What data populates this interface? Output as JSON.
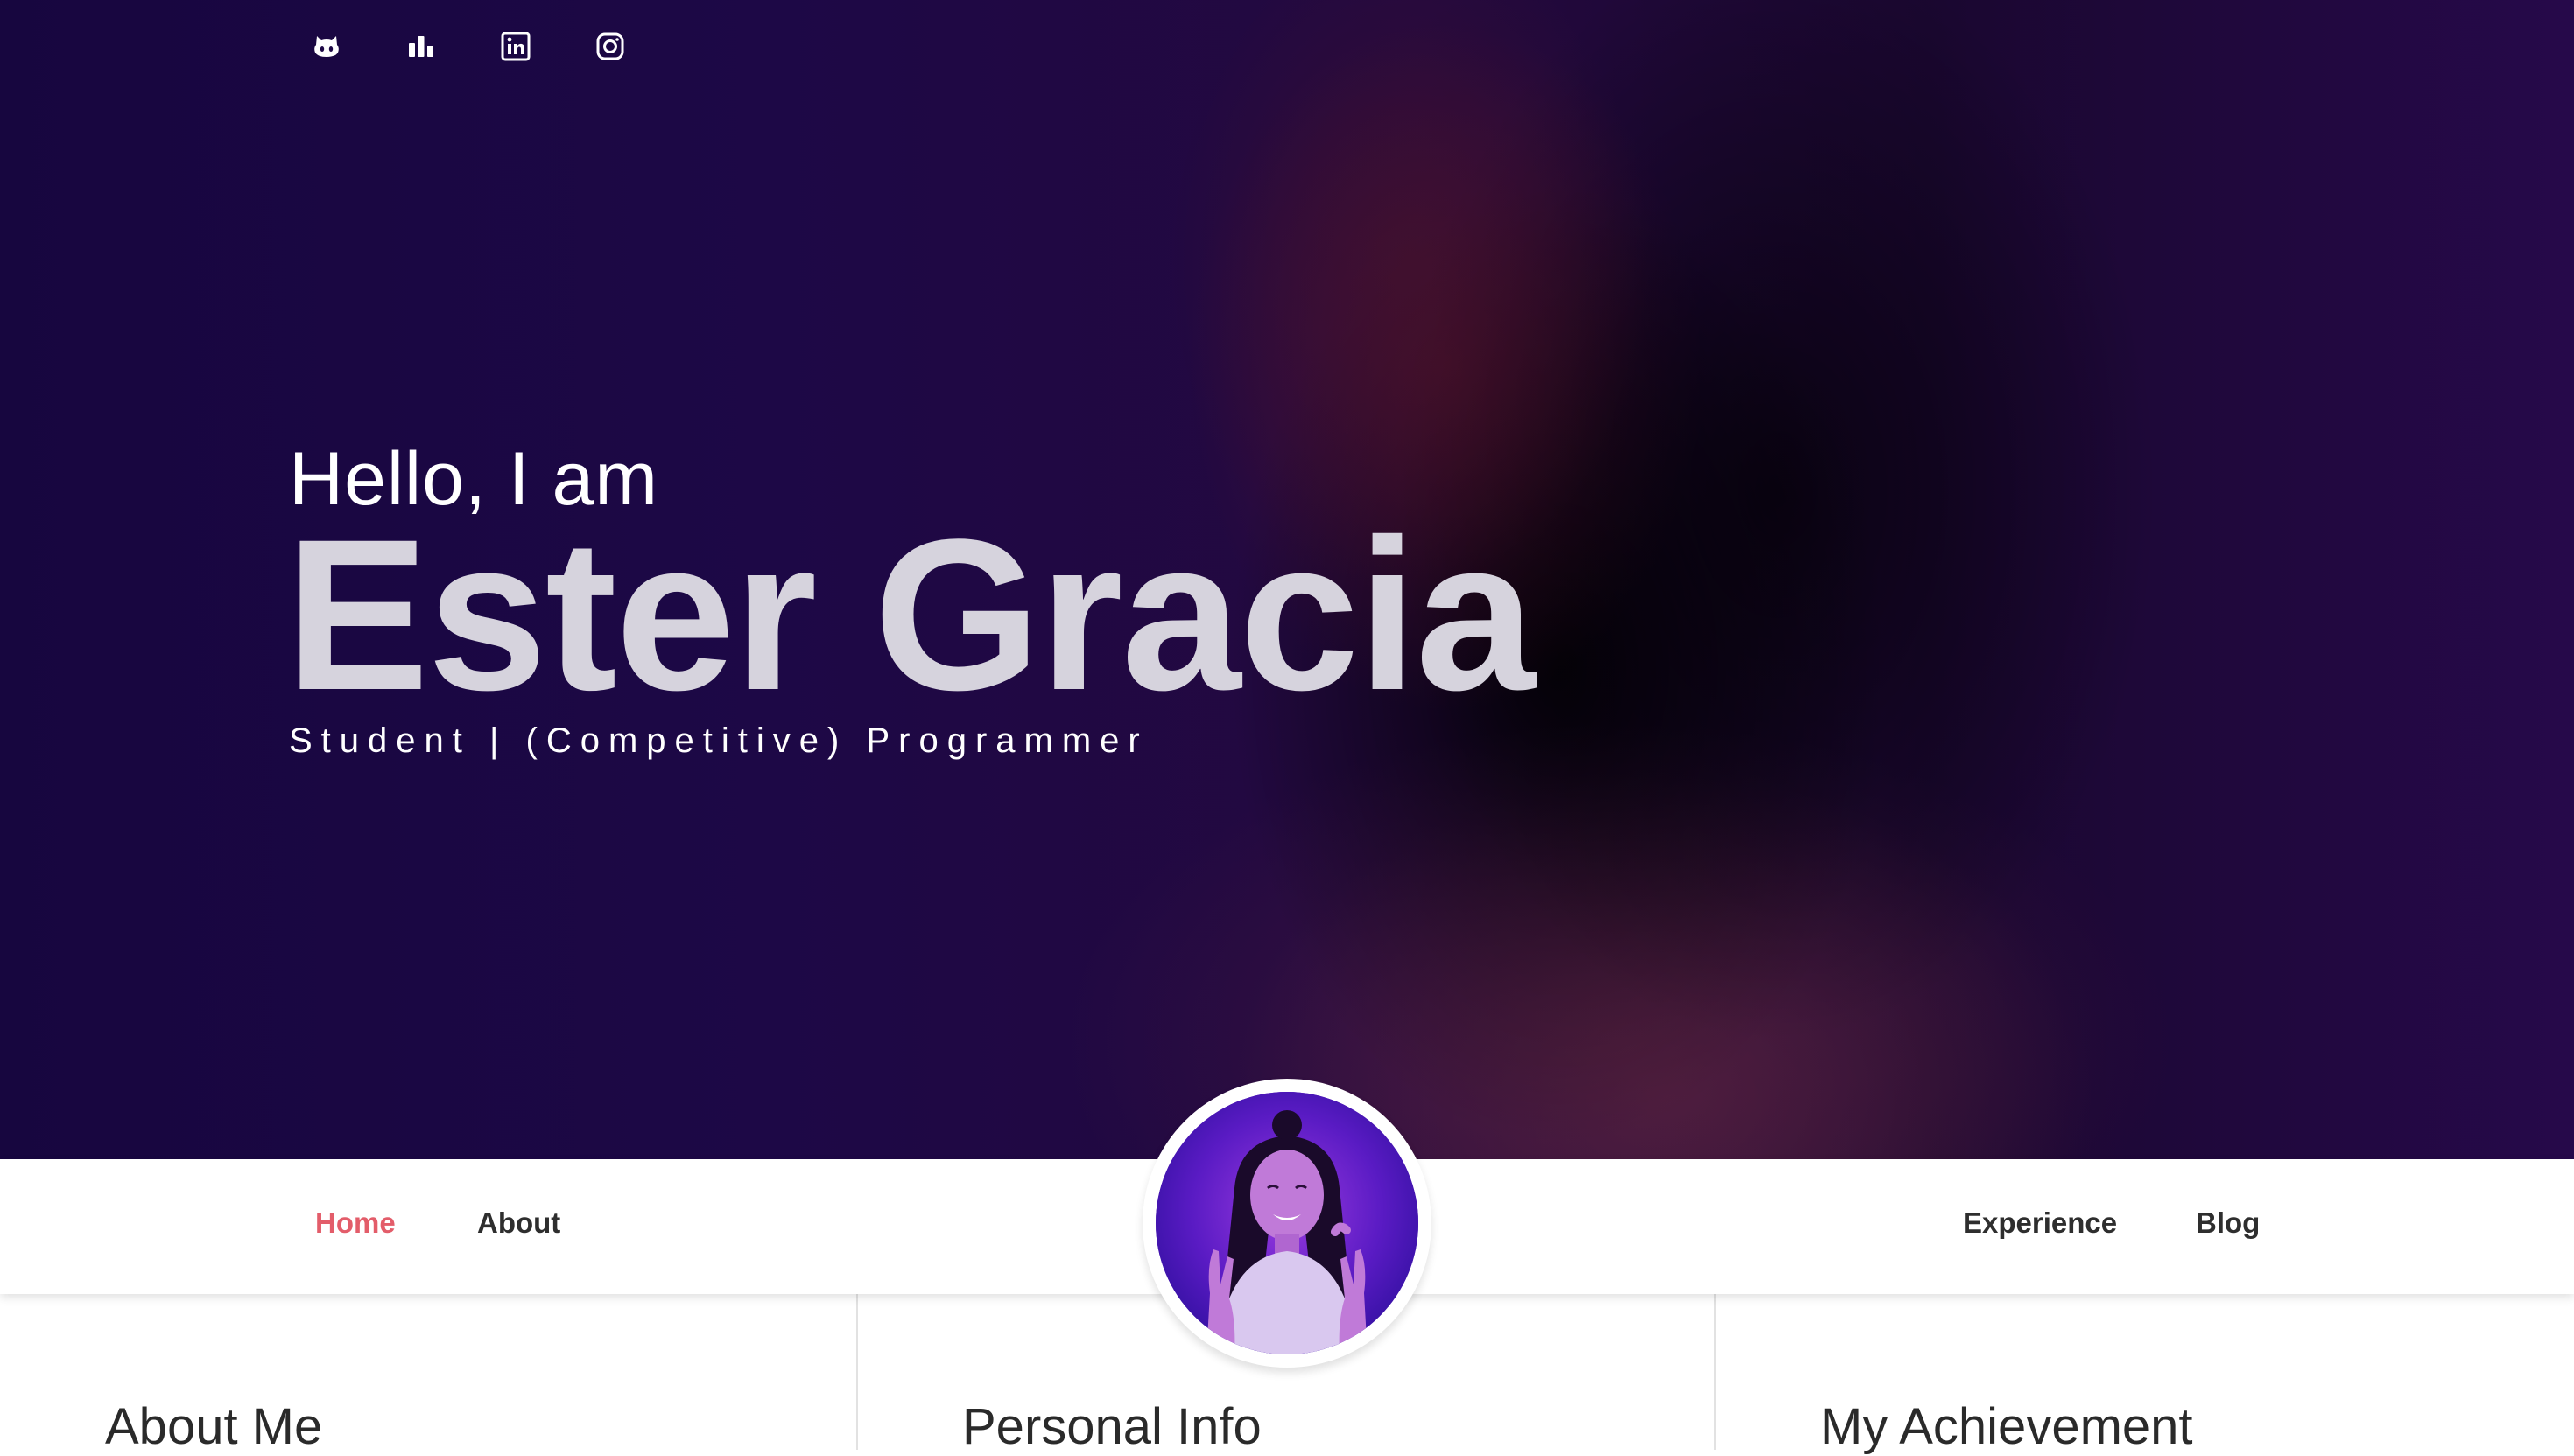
{
  "socials": [
    {
      "name": "github-icon"
    },
    {
      "name": "stats-icon"
    },
    {
      "name": "linkedin-icon"
    },
    {
      "name": "instagram-icon"
    }
  ],
  "hero": {
    "greeting": "Hello, I am",
    "name": "Ester Gracia",
    "tagline": "Student | (Competitive) Programmer"
  },
  "nav": {
    "home": "Home",
    "about": "About",
    "experience": "Experience",
    "blog": "Blog",
    "active": "Home"
  },
  "sections": {
    "about_me": "About Me",
    "personal_info": "Personal Info",
    "my_achievement": "My Achievement"
  },
  "colors": {
    "accent": "#e35d6a",
    "hero_bg": "#1d0846",
    "name_text": "#d6d3dd"
  }
}
